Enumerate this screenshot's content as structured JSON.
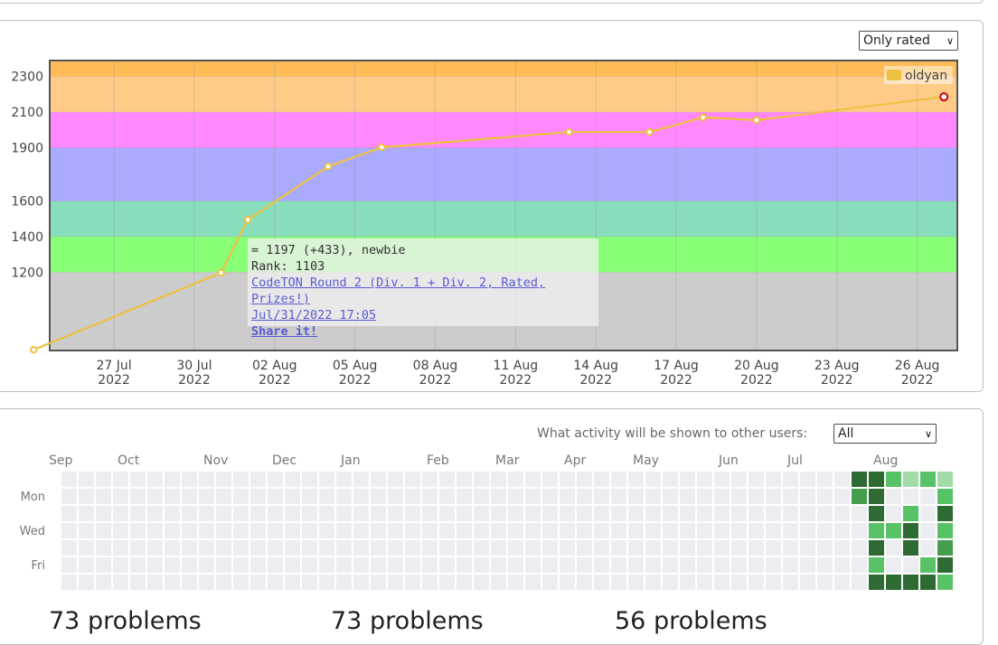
{
  "rating_selector": {
    "selected": "Only rated"
  },
  "chart_data": {
    "type": "line",
    "y_ticks": [
      1200,
      1400,
      1600,
      1900,
      2100,
      2300
    ],
    "ylim": [
      760,
      2390
    ],
    "x_tick_labels": [
      [
        "27 Jul",
        "2022"
      ],
      [
        "30 Jul",
        "2022"
      ],
      [
        "02 Aug",
        "2022"
      ],
      [
        "05 Aug",
        "2022"
      ],
      [
        "08 Aug",
        "2022"
      ],
      [
        "11 Aug",
        "2022"
      ],
      [
        "14 Aug",
        "2022"
      ],
      [
        "17 Aug",
        "2022"
      ],
      [
        "20 Aug",
        "2022"
      ],
      [
        "23 Aug",
        "2022"
      ],
      [
        "26 Aug",
        "2022"
      ]
    ],
    "xlim_days_from_27jul": [
      -2.4,
      31.5
    ],
    "rating_bands": [
      {
        "from": 760,
        "to": 1200,
        "color": "#cccccc"
      },
      {
        "from": 1200,
        "to": 1400,
        "color": "#88ff77"
      },
      {
        "from": 1400,
        "to": 1600,
        "color": "#88ddbb"
      },
      {
        "from": 1600,
        "to": 1900,
        "color": "#aaaaff"
      },
      {
        "from": 1900,
        "to": 2100,
        "color": "#ff88ff"
      },
      {
        "from": 2100,
        "to": 2300,
        "color": "#ffcc88"
      },
      {
        "from": 2300,
        "to": 2390,
        "color": "#ffbb55"
      }
    ],
    "series": [
      {
        "name": "oldyan",
        "color": "#edc240",
        "points": [
          {
            "date": "2022-07-24",
            "rating": 764
          },
          {
            "date": "2022-07-31",
            "rating": 1197
          },
          {
            "date": "2022-08-01",
            "rating": 1495
          },
          {
            "date": "2022-08-04",
            "rating": 1795
          },
          {
            "date": "2022-08-06",
            "rating": 1902
          },
          {
            "date": "2022-08-13",
            "rating": 1988
          },
          {
            "date": "2022-08-16",
            "rating": 1988
          },
          {
            "date": "2022-08-18",
            "rating": 2070
          },
          {
            "date": "2022-08-20",
            "rating": 2055
          },
          {
            "date": "2022-08-27",
            "rating": 2186
          }
        ]
      }
    ]
  },
  "tooltip": {
    "line1": "= 1197 (+433), newbie",
    "line2": "Rank: 1103",
    "contest": "CodeTON Round 2 (Div. 1 + Div. 2, Rated, Prizes!)",
    "time": "Jul/31/2022 17:05",
    "share": "Share it!"
  },
  "activity": {
    "caption": "What activity will be shown to other users:",
    "filter_selected": "All",
    "months": [
      "Sep",
      "Oct",
      "Nov",
      "Dec",
      "Jan",
      "Feb",
      "Mar",
      "Apr",
      "May",
      "Jun",
      "Jul",
      "Aug"
    ],
    "day_labels": [
      "Mon",
      "Wed",
      "Fri"
    ],
    "empty_color": "#ebedf0",
    "level_colors": [
      "#ebedf0",
      "#a1dba7",
      "#58c266",
      "#449e4c",
      "#2e6b33"
    ],
    "recent_weeks": [
      [
        4,
        3,
        0,
        0,
        0,
        0,
        0
      ],
      [
        4,
        4,
        4,
        2,
        4,
        2,
        4
      ],
      [
        2,
        0,
        0,
        2,
        0,
        0,
        4
      ],
      [
        1,
        0,
        2,
        4,
        4,
        0,
        4
      ],
      [
        2,
        0,
        0,
        0,
        0,
        2,
        4
      ],
      [
        1,
        2,
        4,
        2,
        3,
        4,
        2
      ]
    ]
  },
  "problem_counts": [
    "73 problems",
    "73 problems",
    "56 problems"
  ]
}
